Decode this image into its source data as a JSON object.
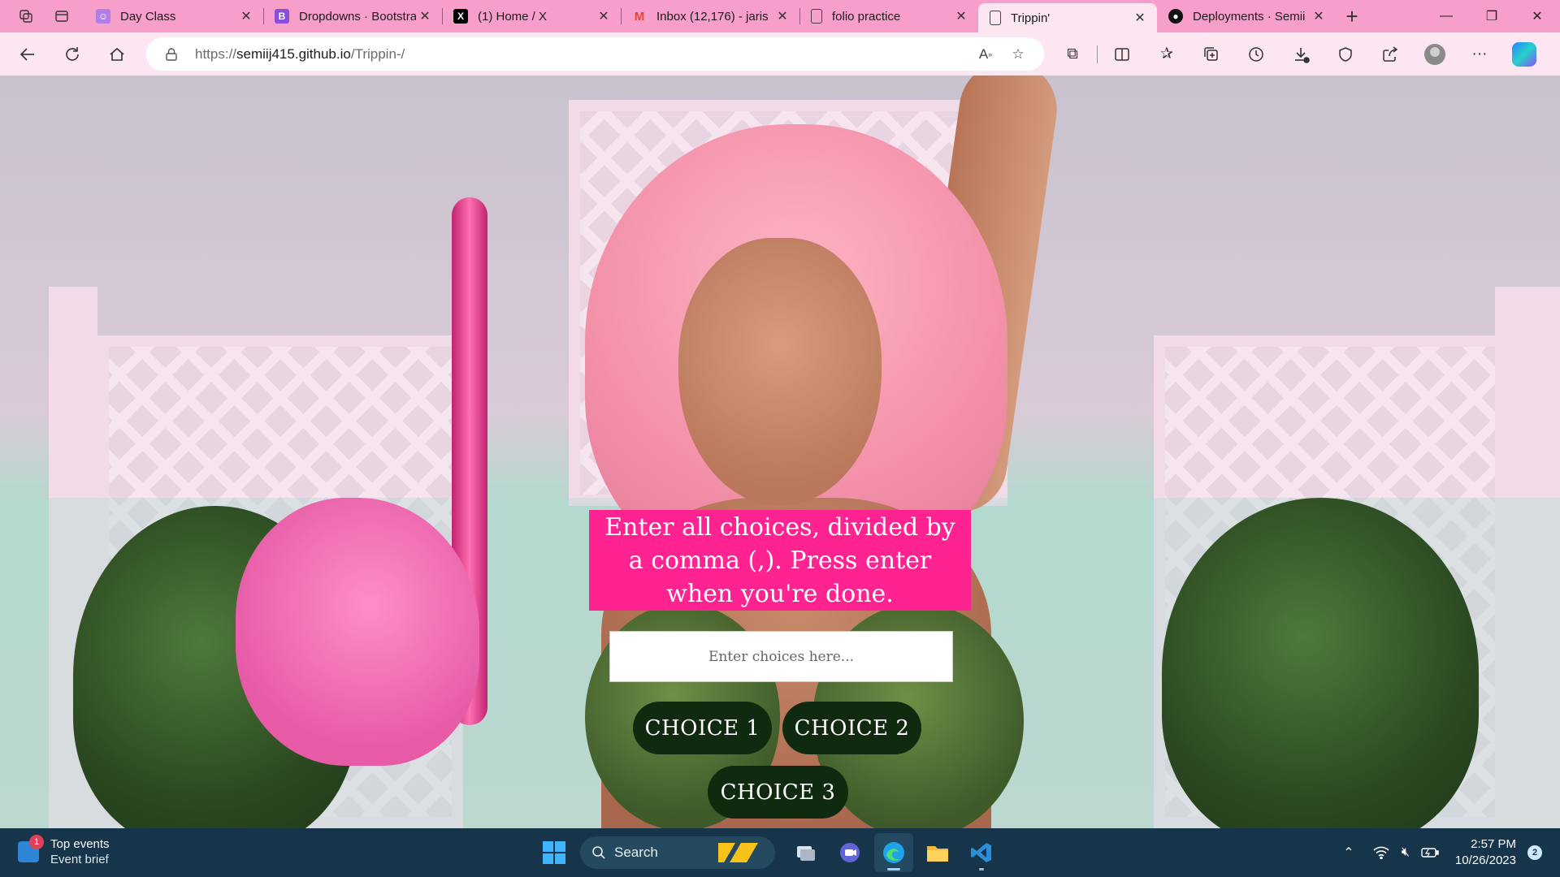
{
  "browser": {
    "tabs": [
      {
        "title": "Day Class",
        "favicon": "profile-icon",
        "color": "#b07fe6",
        "active": false
      },
      {
        "title": "Dropdowns · Bootstrap",
        "favicon": "bootstrap-icon",
        "color": "#8a4fd8",
        "active": false
      },
      {
        "title": "(1) Home / X",
        "favicon": "x-icon",
        "color": "#000000",
        "active": false
      },
      {
        "title": "Inbox (12,176) - jaris",
        "favicon": "gmail-icon",
        "color": "#ea4335",
        "active": false
      },
      {
        "title": "folio practice",
        "favicon": "document-icon",
        "color": "#555555",
        "active": false
      },
      {
        "title": "Trippin'",
        "favicon": "document-icon",
        "color": "#555555",
        "active": true
      },
      {
        "title": "Deployments · Semii",
        "favicon": "github-icon",
        "color": "#111111",
        "active": false
      }
    ],
    "address": {
      "prefix": "https://",
      "host": "semiij415.github.io",
      "path": "/Trippin-/"
    },
    "tab_strip_color": "#f79ecb",
    "toolbar_color": "#fce6f1"
  },
  "page": {
    "prompt": "Enter all choices, divided by a comma (,). Press enter when you're done.",
    "input_placeholder": "Enter choices here...",
    "choices": [
      "CHOICE 1",
      "CHOICE 2",
      "CHOICE 3"
    ],
    "accent_color": "#ff2391",
    "button_color": "#0f2a0f"
  },
  "taskbar": {
    "widget_title": "Top events",
    "widget_subtitle": "Event brief",
    "widget_badge": "1",
    "search_placeholder": "Search",
    "time": "2:57 PM",
    "date": "10/26/2023",
    "notification_count": "2",
    "apps": [
      "file-explorer-icon",
      "teams-icon",
      "edge-icon",
      "folder-icon",
      "vscode-icon"
    ]
  }
}
